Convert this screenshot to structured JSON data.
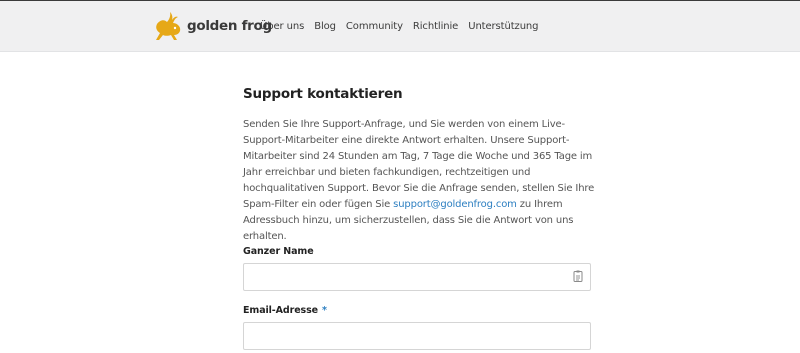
{
  "header": {
    "brand": "golden frog",
    "nav": [
      "Über uns",
      "Blog",
      "Community",
      "Richtlinie",
      "Unterstützung"
    ]
  },
  "main": {
    "title": "Support kontaktieren",
    "intro_before_link": "Senden Sie Ihre Support-Anfrage, und Sie werden von einem Live-Support-Mitarbeiter eine direkte Antwort erhalten. Unsere Support-Mitarbeiter sind 24 Stunden am Tag, 7 Tage die Woche und 365 Tage im Jahr erreichbar und bieten fachkundigen, rechtzeitigen und hochqualitativen Support. Bevor Sie die Anfrage senden, stellen Sie Ihre Spam-Filter ein oder fügen Sie",
    "intro_link": "support@goldenfrog.com",
    "intro_after_link": "zu Ihrem Adressbuch hinzu, um sicherzustellen, dass Sie die Antwort von uns erhalten."
  },
  "form": {
    "name_label": "Ganzer Name",
    "name_value": "",
    "name_icon": "contact-card-icon",
    "email_label": "Email-Adresse",
    "email_required_marker": "*",
    "email_value": ""
  },
  "colors": {
    "header_bg": "#f0f0f1",
    "link": "#2d7fc1",
    "logo_gold": "#e6a817"
  }
}
